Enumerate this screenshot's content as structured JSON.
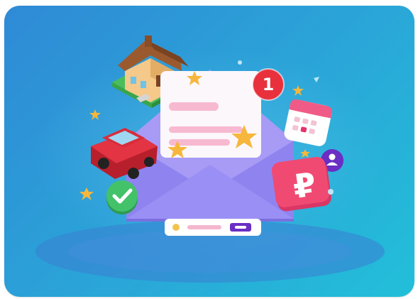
{
  "illustration": {
    "notification_count": "1",
    "currency_symbol": "₽"
  },
  "colors": {
    "background_start": "#2f8ad6",
    "background_end": "#22bfd9",
    "envelope": "#8c7ff0",
    "badge": "#e8313d",
    "coin_tile": "#f04a73",
    "car": "#d92c3a",
    "check": "#43c26a",
    "star": "#f6b73c"
  }
}
